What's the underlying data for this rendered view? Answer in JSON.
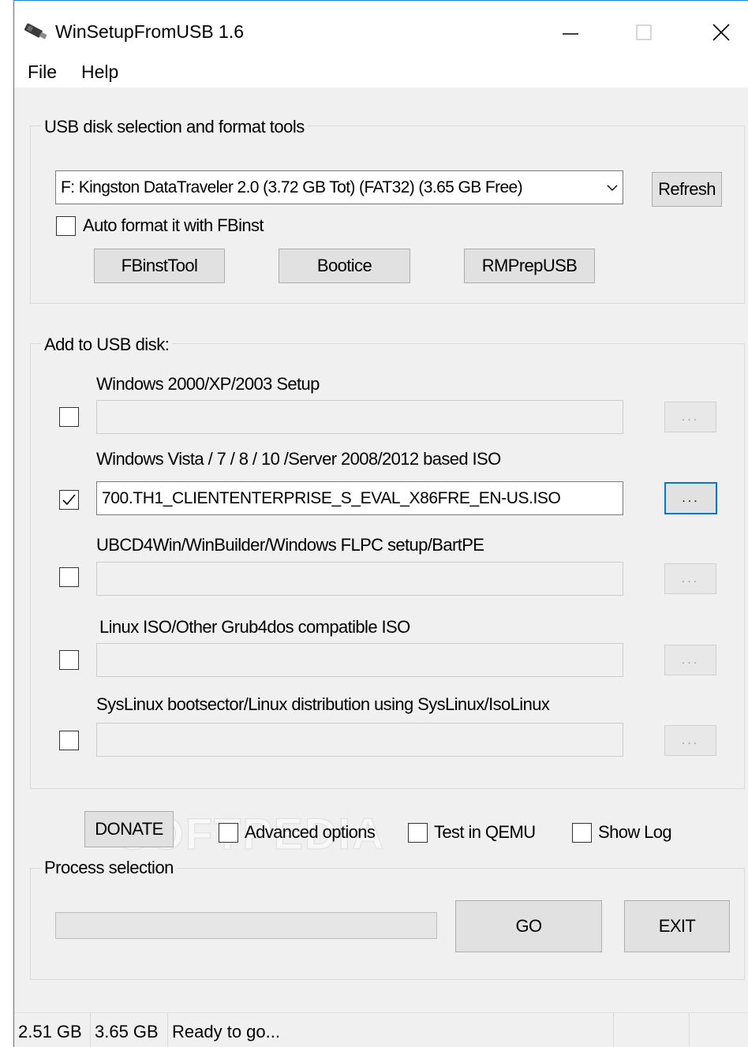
{
  "window": {
    "title": "WinSetupFromUSB 1.6",
    "icon": "usb-stick-icon",
    "controls": {
      "minimize": "minimize-icon",
      "maximize": "maximize-icon",
      "close": "close-icon"
    }
  },
  "menu": {
    "file": "File",
    "help": "Help"
  },
  "usb_group": {
    "title": "USB disk selection and format tools",
    "selected_disk": "F: Kingston DataTraveler 2.0 (3.72 GB Tot) (FAT32) (3.65 GB Free)",
    "refresh": "Refresh",
    "auto_format_label": "Auto format it with FBinst",
    "auto_format_checked": false,
    "tools": [
      "FBinstTool",
      "Bootice",
      "RMPrepUSB"
    ]
  },
  "add_group": {
    "title": "Add to USB disk:",
    "browse_label": "...",
    "entries": [
      {
        "label": "Windows 2000/XP/2003 Setup",
        "checked": false,
        "value": ""
      },
      {
        "label": "Windows Vista / 7 / 8 / 10 /Server 2008/2012 based ISO",
        "checked": true,
        "value": "700.TH1_CLIENTENTERPRISE_S_EVAL_X86FRE_EN-US.ISO"
      },
      {
        "label": "UBCD4Win/WinBuilder/Windows FLPC setup/BartPE",
        "checked": false,
        "value": ""
      },
      {
        "label": "Linux ISO/Other Grub4dos compatible ISO",
        "checked": false,
        "value": ""
      },
      {
        "label": "SysLinux bootsector/Linux distribution using SysLinux/IsoLinux",
        "checked": false,
        "value": ""
      }
    ]
  },
  "options": {
    "donate": "DONATE",
    "advanced": "Advanced options",
    "qemu": "Test in QEMU",
    "show_log": "Show Log",
    "watermark": "SOFTPEDIA"
  },
  "process": {
    "title": "Process selection",
    "progress": 0,
    "go": "GO",
    "exit": "EXIT"
  },
  "status": {
    "size1": "2.51 GB",
    "size2": "3.65 GB",
    "message": "Ready to go..."
  }
}
